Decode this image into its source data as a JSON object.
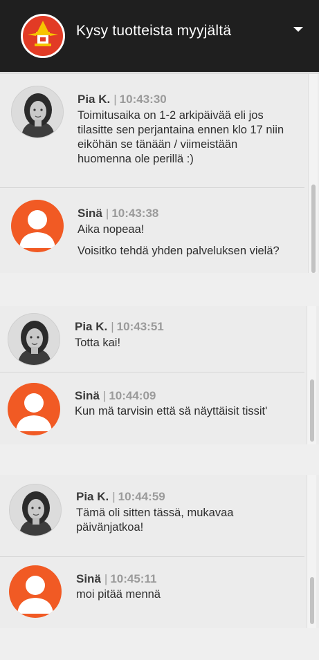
{
  "header": {
    "title": "Kysy tuotteista myyjältä",
    "logo_icon": "lighthouse-logo-icon",
    "dropdown_icon": "caret-down-icon"
  },
  "colors": {
    "header_bg": "#1f1f1f",
    "user_avatar": "#f15a24",
    "background": "#ececec"
  },
  "panels": [
    {
      "messages": [
        {
          "sender": "Pia K.",
          "separator": "|",
          "time": "10:43:30",
          "avatar": "agent-avatar",
          "paragraphs": [
            "Toimitusaika on 1-2 arkipäivää eli jos tilasitte sen perjantaina ennen klo 17 niin eiköhän se tänään / viimeistään huomenna ole perillä :)"
          ]
        },
        {
          "sender": "Sinä",
          "separator": "|",
          "time": "10:43:38",
          "avatar": "user-avatar",
          "paragraphs": [
            "Aika nopeaa!",
            "Voisitko tehdä yhden palveluksen vielä?"
          ]
        }
      ]
    },
    {
      "messages": [
        {
          "sender": "Pia K.",
          "separator": "|",
          "time": "10:43:51",
          "avatar": "agent-avatar",
          "paragraphs": [
            "Totta kai!"
          ]
        },
        {
          "sender": "Sinä",
          "separator": "|",
          "time": "10:44:09",
          "avatar": "user-avatar",
          "paragraphs": [
            "Kun mä tarvisin että sä näyttäisit tissit'"
          ]
        }
      ]
    },
    {
      "messages": [
        {
          "sender": "Pia K.",
          "separator": "|",
          "time": "10:44:59",
          "avatar": "agent-avatar",
          "paragraphs": [
            "Tämä oli sitten tässä, mukavaa päivänjatkoa!"
          ]
        },
        {
          "sender": "Sinä",
          "separator": "|",
          "time": "10:45:11",
          "avatar": "user-avatar",
          "paragraphs": [
            "moi pitää mennä"
          ]
        }
      ]
    }
  ]
}
